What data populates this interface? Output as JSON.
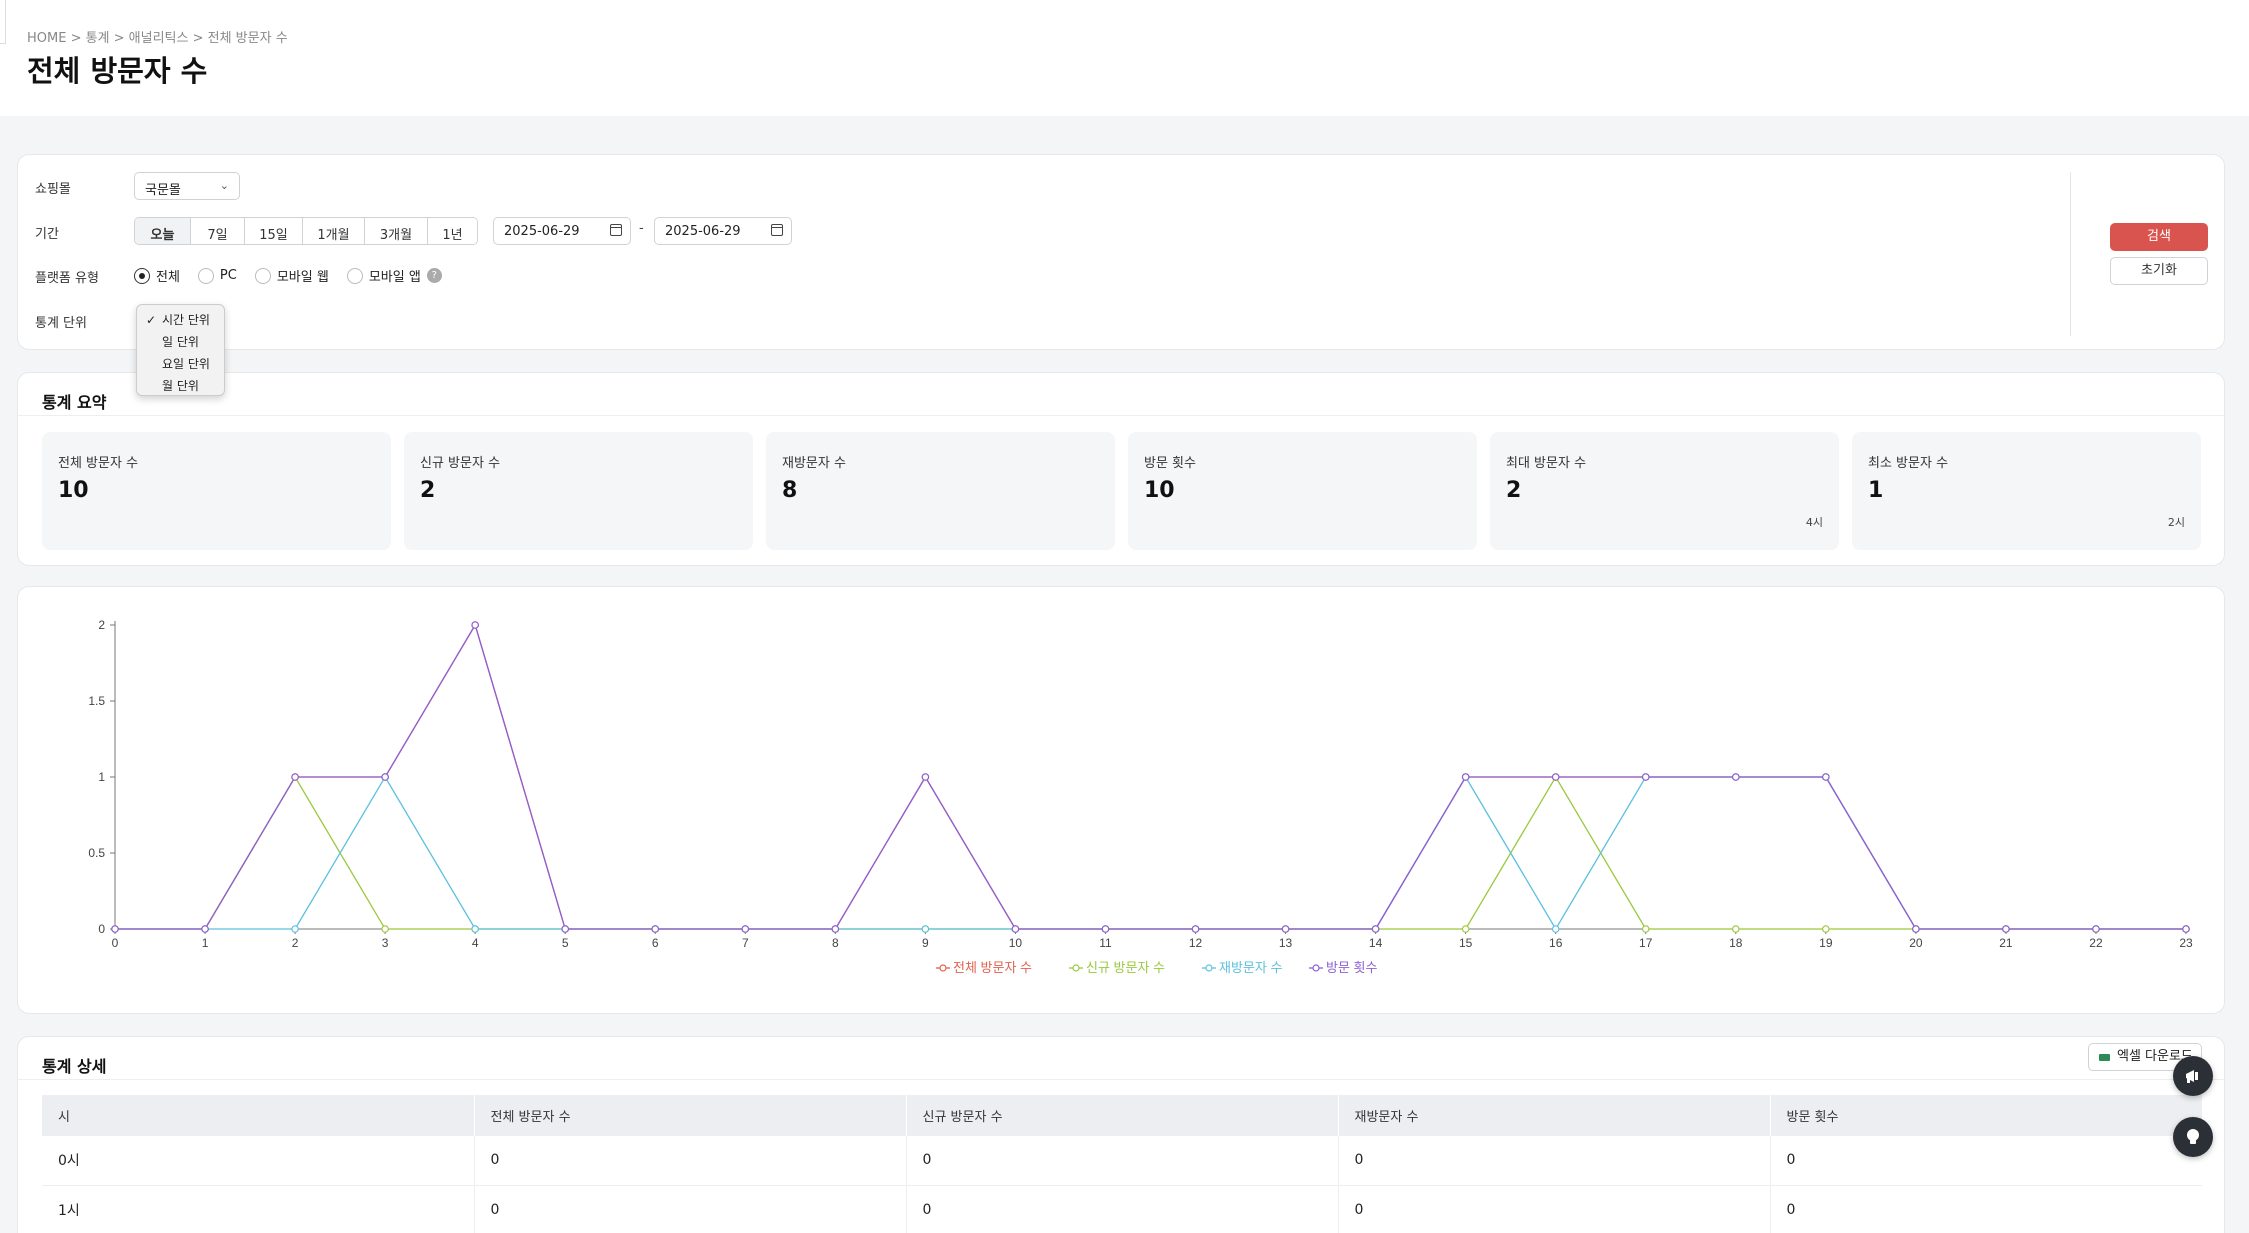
{
  "header": {
    "breadcrumb": "HOME > 통계 > 애널리틱스 > 전체 방문자 수",
    "title": "전체 방문자 수"
  },
  "filters": {
    "mall_label": "쇼핑몰",
    "mall_value": "국문몰",
    "period_label": "기간",
    "period_options": [
      "오늘",
      "7일",
      "15일",
      "1개월",
      "3개월",
      "1년"
    ],
    "period_selected": "오늘",
    "date_from": "2025-06-29",
    "date_separator": "-",
    "date_to": "2025-06-29",
    "platform_label": "플랫폼 유형",
    "platform_options": [
      "전체",
      "PC",
      "모바일 웹",
      "모바일 앱"
    ],
    "platform_selected": "전체",
    "unit_label": "통계 단위",
    "unit_options": [
      "시간 단위",
      "일 단위",
      "요일 단위",
      "월 단위"
    ],
    "unit_selected": "시간 단위",
    "check_mark": "✓",
    "help_mark": "?",
    "search_label": "검색",
    "reset_label": "초기화"
  },
  "summary": {
    "title": "통계 요약",
    "cards": [
      {
        "label": "전체 방문자 수",
        "value": "10",
        "sub": ""
      },
      {
        "label": "신규 방문자 수",
        "value": "2",
        "sub": ""
      },
      {
        "label": "재방문자 수",
        "value": "8",
        "sub": ""
      },
      {
        "label": "방문 횟수",
        "value": "10",
        "sub": ""
      },
      {
        "label": "최대 방문자 수",
        "value": "2",
        "sub": "4시"
      },
      {
        "label": "최소 방문자 수",
        "value": "1",
        "sub": "2시"
      }
    ]
  },
  "chart_data": {
    "type": "line",
    "x": [
      0,
      1,
      2,
      3,
      4,
      5,
      6,
      7,
      8,
      9,
      10,
      11,
      12,
      13,
      14,
      15,
      16,
      17,
      18,
      19,
      20,
      21,
      22,
      23
    ],
    "ylim": [
      0,
      2
    ],
    "yticks": [
      "0",
      "0.5",
      "1",
      "1.5",
      "2"
    ],
    "grid": false,
    "legend": "bottom-center",
    "series": [
      {
        "name": "전체 방문자 수",
        "color": "#e0614f",
        "values": [
          0,
          0,
          1,
          1,
          2,
          0,
          0,
          0,
          0,
          1,
          0,
          0,
          0,
          0,
          0,
          1,
          1,
          1,
          1,
          1,
          0,
          0,
          0,
          0
        ]
      },
      {
        "name": "신규 방문자 수",
        "color": "#9bc83f",
        "values": [
          0,
          0,
          1,
          0,
          0,
          0,
          0,
          0,
          0,
          0,
          0,
          0,
          0,
          0,
          0,
          0,
          1,
          0,
          0,
          0,
          0,
          0,
          0,
          0
        ]
      },
      {
        "name": "재방문자 수",
        "color": "#5bc0de",
        "values": [
          0,
          0,
          0,
          1,
          0,
          0,
          0,
          0,
          0,
          0,
          0,
          0,
          0,
          0,
          0,
          1,
          0,
          1,
          1,
          1,
          0,
          0,
          0,
          0
        ]
      },
      {
        "name": "방문 횟수",
        "color": "#8e5fd4",
        "values": [
          0,
          0,
          1,
          1,
          2,
          0,
          0,
          0,
          0,
          1,
          0,
          0,
          0,
          0,
          0,
          1,
          1,
          1,
          1,
          1,
          0,
          0,
          0,
          0
        ]
      }
    ]
  },
  "detail": {
    "title": "통계 상세",
    "excel_label": "엑셀 다운로드",
    "columns": [
      "시",
      "전체 방문자 수",
      "신규 방문자 수",
      "재방문자 수",
      "방문 횟수"
    ],
    "rows": [
      [
        "0시",
        "0",
        "0",
        "0",
        "0"
      ],
      [
        "1시",
        "0",
        "0",
        "0",
        "0"
      ]
    ]
  }
}
